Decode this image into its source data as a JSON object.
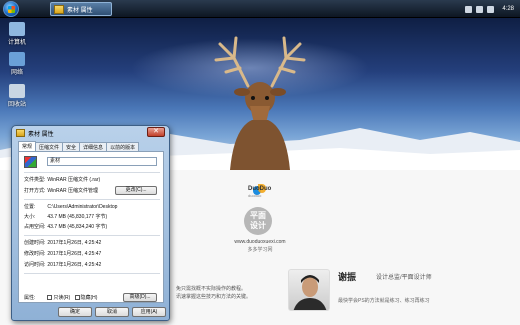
{
  "taskbar": {
    "task_label": "素材 属性",
    "clock": "4:28"
  },
  "desktop_icons": [
    {
      "label": "计算机",
      "icon": "computer-icon",
      "color": "#8fb8e0"
    },
    {
      "label": "网络",
      "icon": "network-icon",
      "color": "#6aa0d8"
    },
    {
      "label": "回收站",
      "icon": "recycle-bin-icon",
      "color": "#c9d6e3"
    }
  ],
  "page": {
    "logo_text": "DuoDuo",
    "logo_sub": "duoduo",
    "circle_line1": "平面",
    "circle_line2": "设计",
    "site_url": "www.duoduoxuexi.com",
    "site_tag": "多多学习网",
    "left_line1": "免只需找概不实际操作的教程。",
    "left_line2": "讯速掌握这些技巧和方法的关键。",
    "author_name": "谢振",
    "author_role": "设计总监/平面设计师",
    "author_desc": "最快学会PS的方法就是练习、练习再练习"
  },
  "dialog": {
    "title": "素材 属性",
    "close_label": "✕",
    "tabs": [
      "常规",
      "压缩文件",
      "安全",
      "详细信息",
      "以前的版本"
    ],
    "active_tab": 0,
    "name_value": "素材",
    "file_type_label": "文件类型:",
    "file_type_value": "WinRAR 压缩文件 (.rar)",
    "open_with_label": "打开方式:",
    "open_with_value": "WinRAR 压缩文件管理",
    "change_button": "更改(C)...",
    "location_label": "位置:",
    "location_value": "C:\\Users\\Administrator\\Desktop",
    "size_label": "大小:",
    "size_value": "43.7 MB (45,830,177 字节)",
    "disk_size_label": "占用空间:",
    "disk_size_value": "43.7 MB (45,834,240 字节)",
    "created_label": "创建时间:",
    "created_value": "2017年1月26日, 4:25:42",
    "modified_label": "修改时间:",
    "modified_value": "2017年1月26日, 4:25:47",
    "accessed_label": "访问时间:",
    "accessed_value": "2017年1月26日, 4:25:42",
    "attributes_label": "属性:",
    "readonly_label": "只读(R)",
    "hidden_label": "隐藏(H)",
    "advanced_button": "高级(D)...",
    "ok_button": "确定",
    "cancel_button": "取消",
    "apply_button": "应用(A)"
  }
}
